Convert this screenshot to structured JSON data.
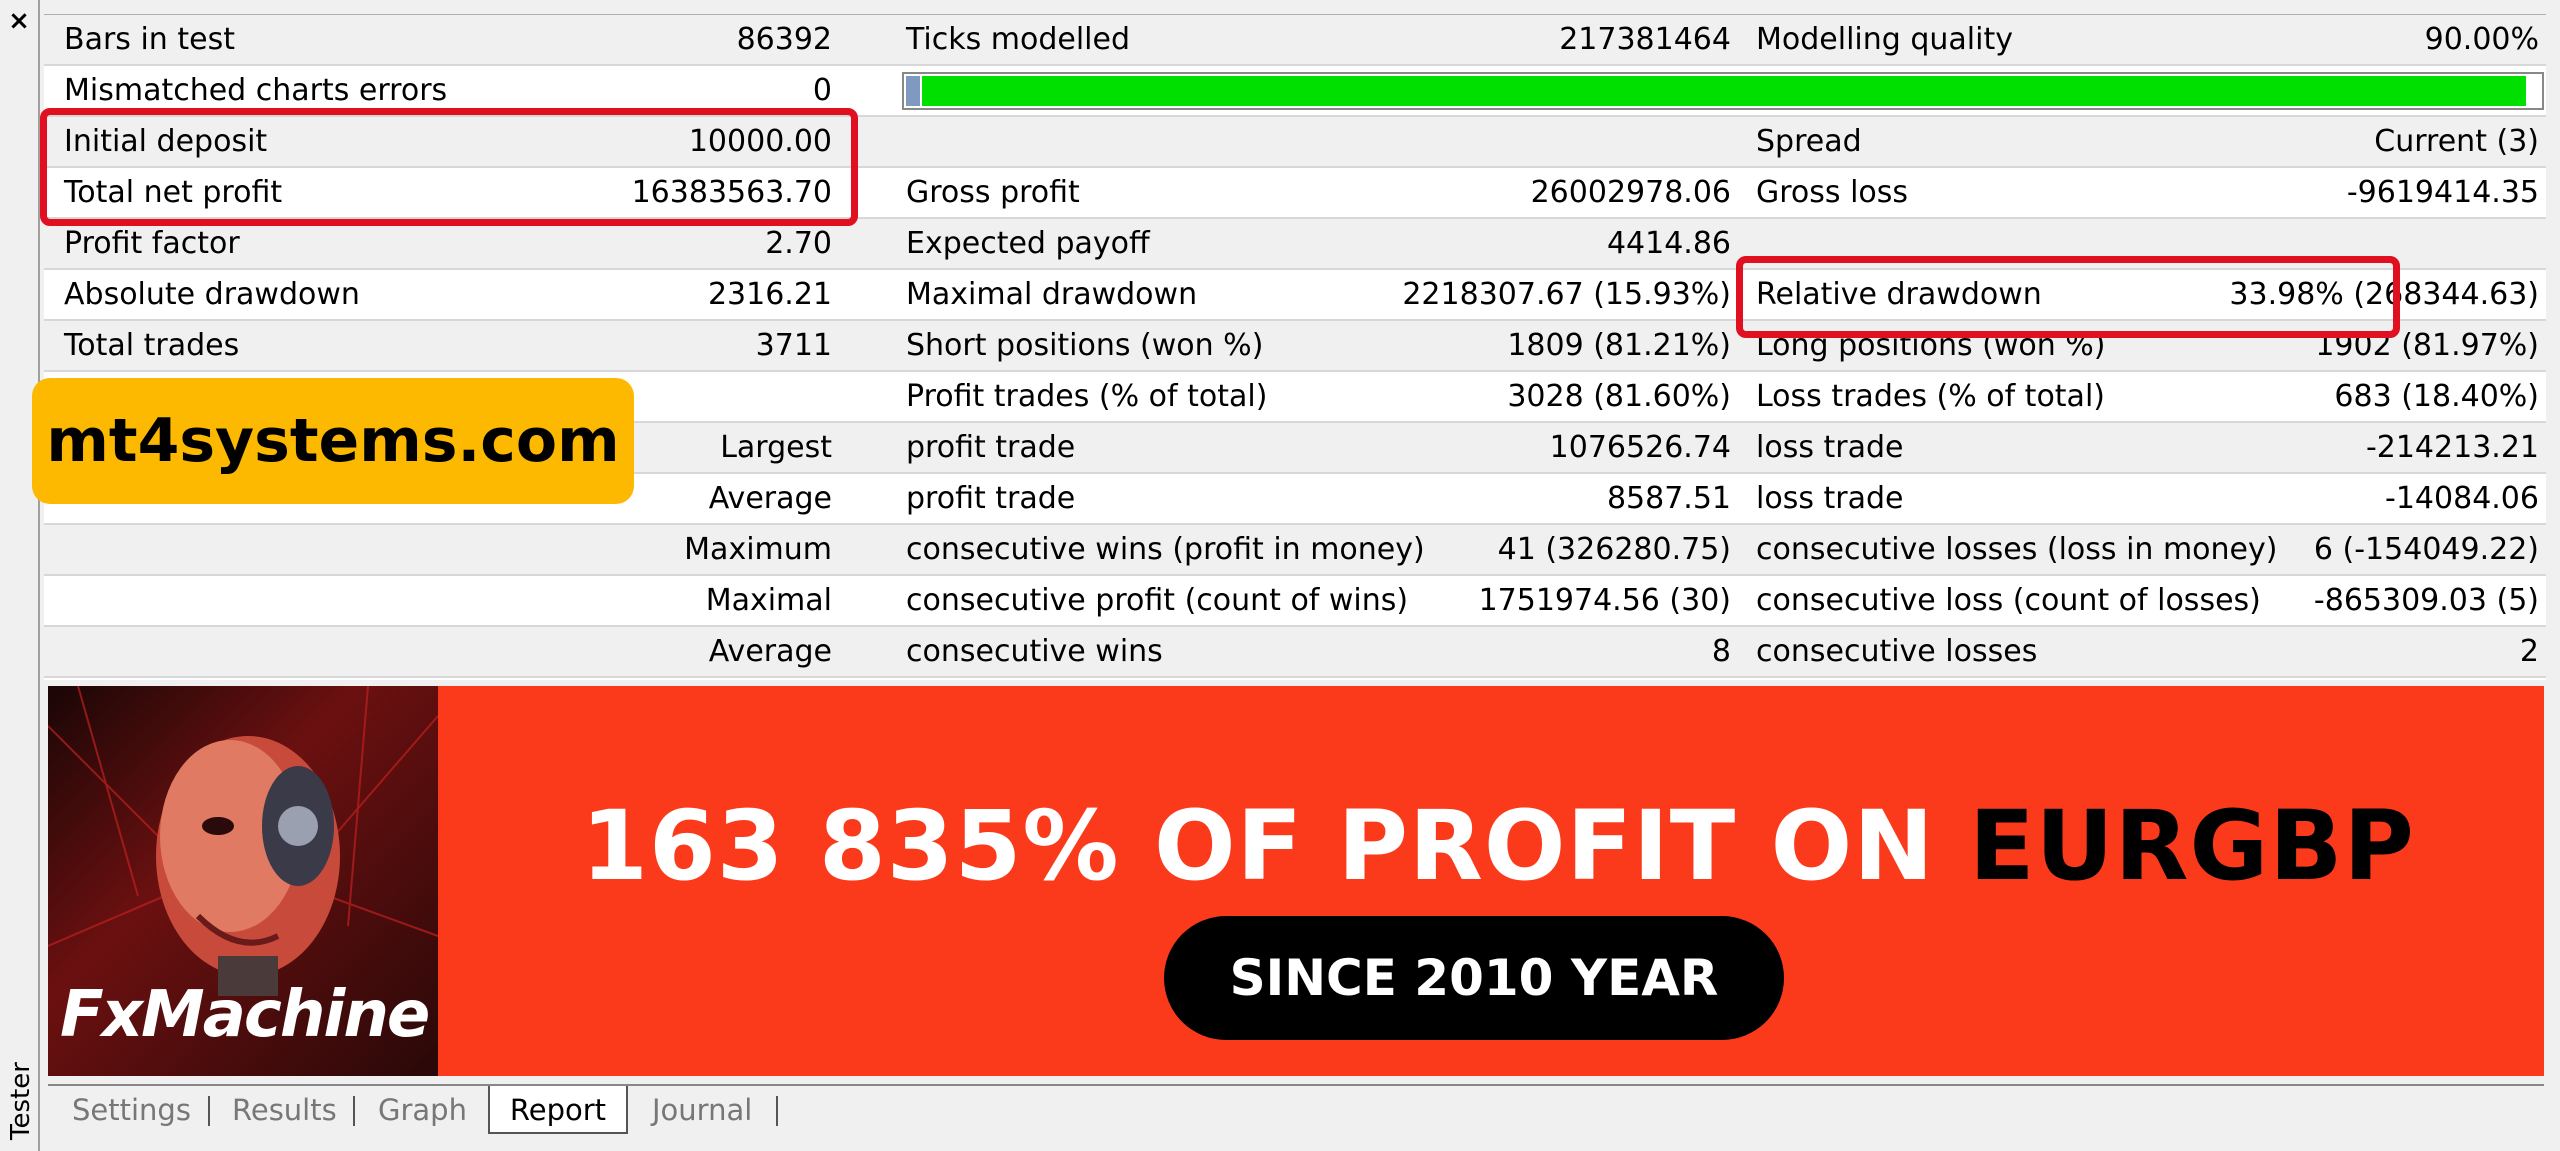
{
  "window": {
    "close_glyph": "×",
    "side_label": "Tester"
  },
  "report": {
    "rows": [
      {
        "c1": "Bars in test",
        "v1": "86392",
        "c2": "Ticks modelled",
        "v2": "217381464",
        "c3": "Modelling quality",
        "v3": "90.00%"
      },
      {
        "c1": "Mismatched charts errors",
        "v1": "0",
        "c2": "",
        "v2": "",
        "c3": "",
        "v3": ""
      },
      {
        "c1": "Initial deposit",
        "v1": "10000.00",
        "c2": "",
        "v2": "",
        "c3": "Spread",
        "v3": "Current (3)"
      },
      {
        "c1": "Total net profit",
        "v1": "16383563.70",
        "c2": "Gross profit",
        "v2": "26002978.06",
        "c3": "Gross loss",
        "v3": "-9619414.35"
      },
      {
        "c1": "Profit factor",
        "v1": "2.70",
        "c2": "Expected payoff",
        "v2": "4414.86",
        "c3": "",
        "v3": ""
      },
      {
        "c1": "Absolute drawdown",
        "v1": "2316.21",
        "c2": "Maximal drawdown",
        "v2": "2218307.67 (15.93%)",
        "c3": "Relative drawdown",
        "v3": "33.98% (268344.63)"
      },
      {
        "c1": "Total trades",
        "v1": "3711",
        "c2": "Short positions (won %)",
        "v2": "1809 (81.21%)",
        "c3": "Long positions (won %)",
        "v3": "1902 (81.97%)"
      },
      {
        "c1": "",
        "v1": "",
        "c2": "Profit trades (% of total)",
        "v2": "3028 (81.60%)",
        "c3": "Loss trades (% of total)",
        "v3": "683 (18.40%)"
      },
      {
        "c1": "",
        "v1": "Largest",
        "c2": "profit trade",
        "v2": "1076526.74",
        "c3": "loss trade",
        "v3": "-214213.21"
      },
      {
        "c1": "",
        "v1": "Average",
        "c2": "profit trade",
        "v2": "8587.51",
        "c3": "loss trade",
        "v3": "-14084.06"
      },
      {
        "c1": "",
        "v1": "Maximum",
        "c2": "consecutive wins (profit in money)",
        "v2": "41 (326280.75)",
        "c3": "consecutive losses (loss in money)",
        "v3": "6 (-154049.22)"
      },
      {
        "c1": "",
        "v1": "Maximal",
        "c2": "consecutive profit (count of wins)",
        "v2": "1751974.56 (30)",
        "c3": "consecutive loss (count of losses)",
        "v3": "-865309.03 (5)"
      },
      {
        "c1": "",
        "v1": "Average",
        "c2": "consecutive wins",
        "v2": "8",
        "c3": "consecutive losses",
        "v3": "2"
      }
    ],
    "modelling_quality_fraction": 0.99,
    "highlight_color": "#e01020"
  },
  "watermark": {
    "text": "mt4systems.com",
    "color": "#fcb900"
  },
  "banner": {
    "logo_text": "FxMachine",
    "headline_main": "163 835% OF PROFIT ON",
    "headline_pair": "EURGBP",
    "pill_text": "SINCE 2010 YEAR",
    "background_color": "#fb3a1c"
  },
  "tabs": [
    {
      "label": "Settings",
      "active": false
    },
    {
      "label": "Results",
      "active": false
    },
    {
      "label": "Graph",
      "active": false
    },
    {
      "label": "Report",
      "active": true
    },
    {
      "label": "Journal",
      "active": false
    }
  ]
}
